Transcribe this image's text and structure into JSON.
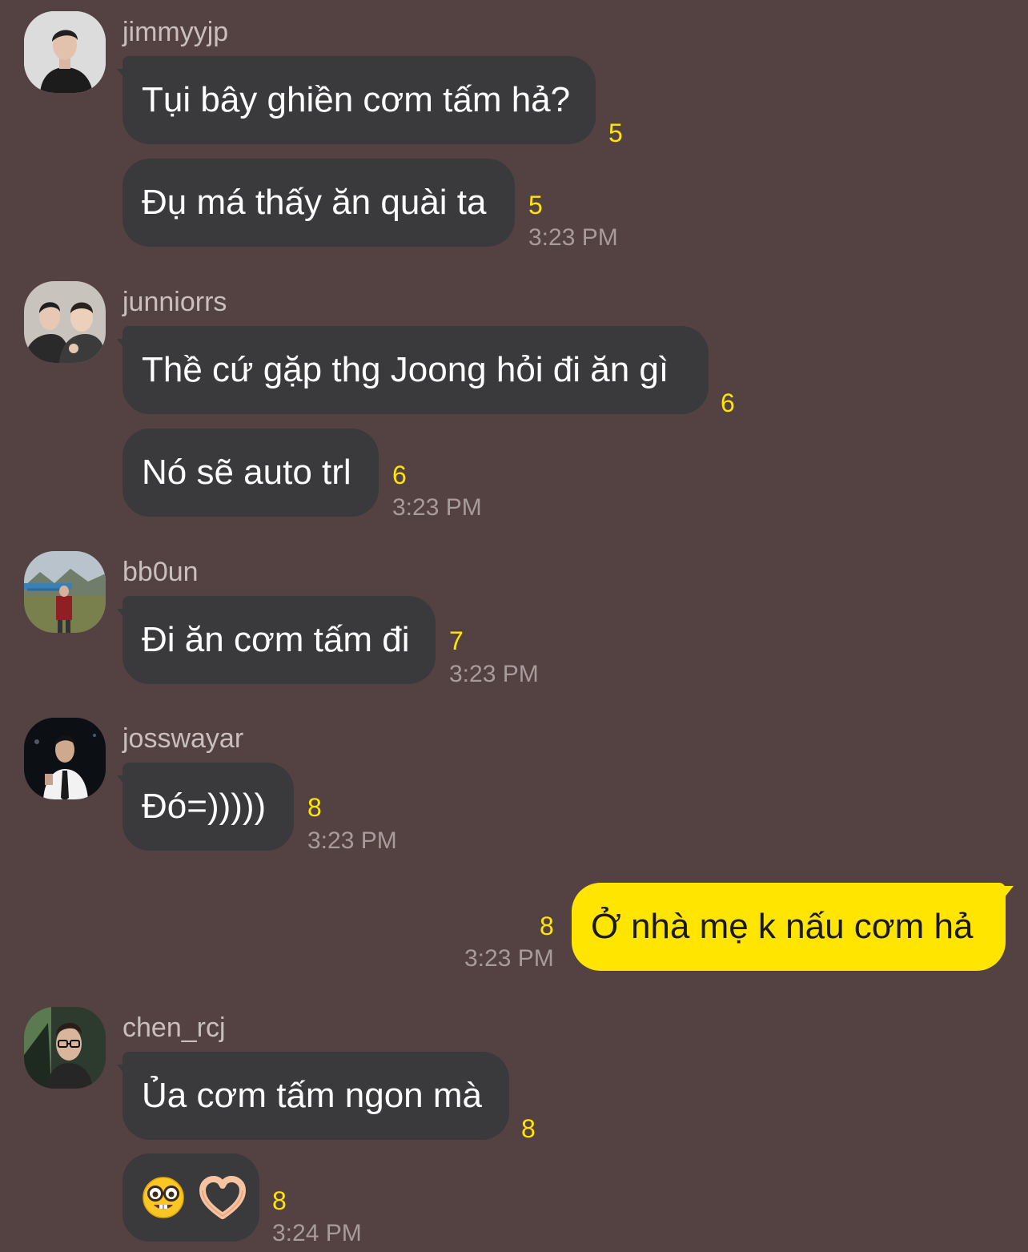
{
  "colors": {
    "background": "#544142",
    "incoming_bubble": "#3a3a3c",
    "outgoing_bubble": "#ffe500",
    "unread_count": "#ffe500",
    "timestamp": "#a79b9b",
    "sender_name": "#c9bfbf"
  },
  "messages": [
    {
      "sender": "jimmyyjp",
      "avatar_icon": "person-portrait-icon",
      "bubbles": [
        {
          "text": "Tụi bây ghiền cơm tấm hả?",
          "unread": "5"
        },
        {
          "text": "Đụ má thấy ăn quài ta",
          "unread": "5",
          "time": "3:23 PM"
        }
      ]
    },
    {
      "sender": "junniorrs",
      "avatar_icon": "two-people-portrait-icon",
      "bubbles": [
        {
          "text": "Thề cứ gặp thg Joong hỏi đi ăn gì",
          "unread": "6"
        },
        {
          "text": "Nó sẽ auto trl",
          "unread": "6",
          "time": "3:23 PM"
        }
      ]
    },
    {
      "sender": "bb0un",
      "avatar_icon": "landscape-person-icon",
      "bubbles": [
        {
          "text": "Đi ăn cơm tấm đi",
          "unread": "7",
          "time": "3:23 PM"
        }
      ]
    },
    {
      "sender": "josswayar",
      "avatar_icon": "person-shirt-tie-icon",
      "bubbles": [
        {
          "text": "Đó=)))))",
          "unread": "8",
          "time": "3:23 PM"
        }
      ]
    },
    {
      "own": true,
      "bubbles": [
        {
          "text": "Ở nhà mẹ k nấu cơm hả",
          "unread": "8",
          "time": "3:23 PM"
        }
      ]
    },
    {
      "sender": "chen_rcj",
      "avatar_icon": "person-glasses-icon",
      "bubbles": [
        {
          "text": "Ủa cơm tấm ngon mà",
          "unread": "8"
        },
        {
          "emojis": [
            "nerd-face-emoji",
            "heart-hands-emoji"
          ],
          "unread": "8",
          "time": "3:24 PM"
        }
      ]
    }
  ]
}
